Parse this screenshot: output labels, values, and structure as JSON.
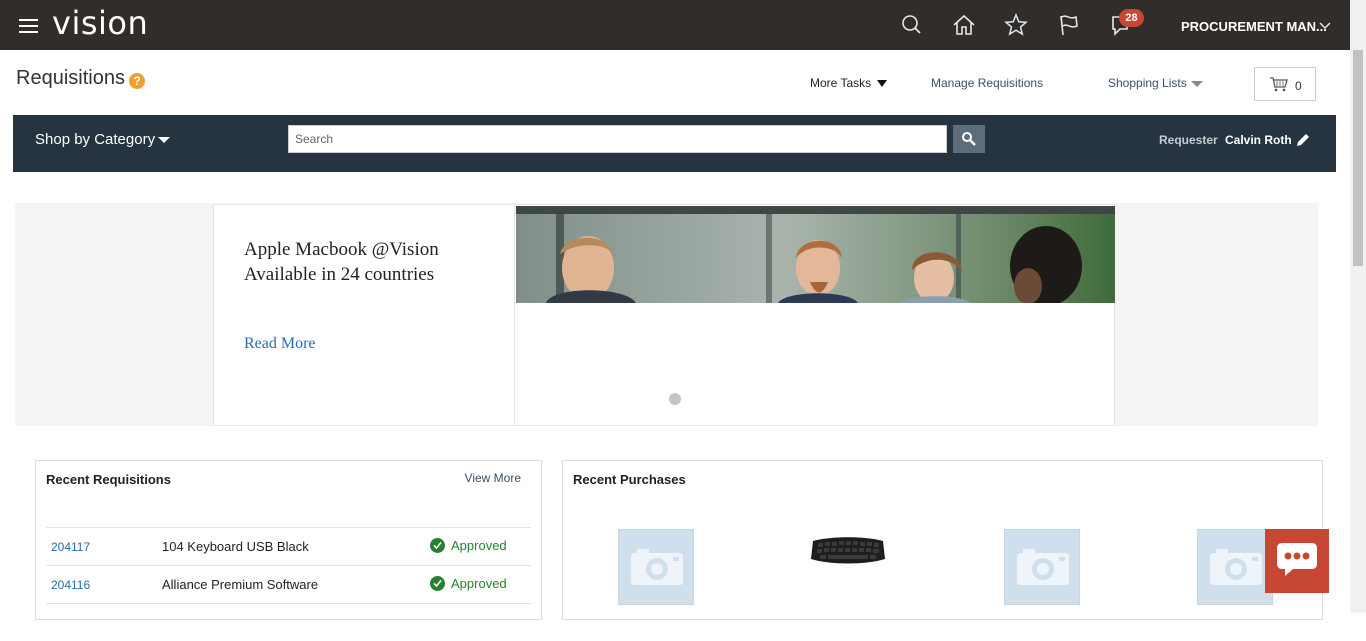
{
  "app": {
    "brand": "vision",
    "notifications_count": "28",
    "user_menu_label": "PROCUREMENT MAN...",
    "icons": [
      "menu-icon",
      "search-icon",
      "home-icon",
      "star-icon",
      "flag-icon",
      "notifications-icon",
      "chevron-down-icon"
    ]
  },
  "page": {
    "title": "Requisitions",
    "help_label": "?",
    "more_tasks": "More Tasks",
    "manage_requisitions": "Manage Requisitions",
    "shopping_lists": "Shopping Lists",
    "cart_count": "0"
  },
  "shopbar": {
    "shop_by_category": "Shop by Category",
    "search_placeholder": "Search",
    "requester_label": "Requester",
    "requester_name": "Calvin Roth"
  },
  "banner": {
    "title_line1": "Apple Macbook @Vision",
    "title_line2": "Available in 24 countries",
    "read_more": "Read More"
  },
  "recent_requisitions": {
    "title": "Recent Requisitions",
    "view_more": "View More",
    "rows": [
      {
        "id": "204117",
        "description": "104 Keyboard USB Black",
        "status": "Approved"
      },
      {
        "id": "204116",
        "description": "Alliance Premium Software",
        "status": "Approved"
      }
    ]
  },
  "recent_purchases": {
    "title": "Recent Purchases",
    "items": [
      "image-placeholder-icon",
      "keyboard-image",
      "image-placeholder-icon",
      "image-placeholder-icon"
    ]
  },
  "colors": {
    "topbar": "#312d2a",
    "shopbar": "#253440",
    "badge": "#c74634",
    "approved": "#27812f",
    "link": "#2b6bb0"
  }
}
